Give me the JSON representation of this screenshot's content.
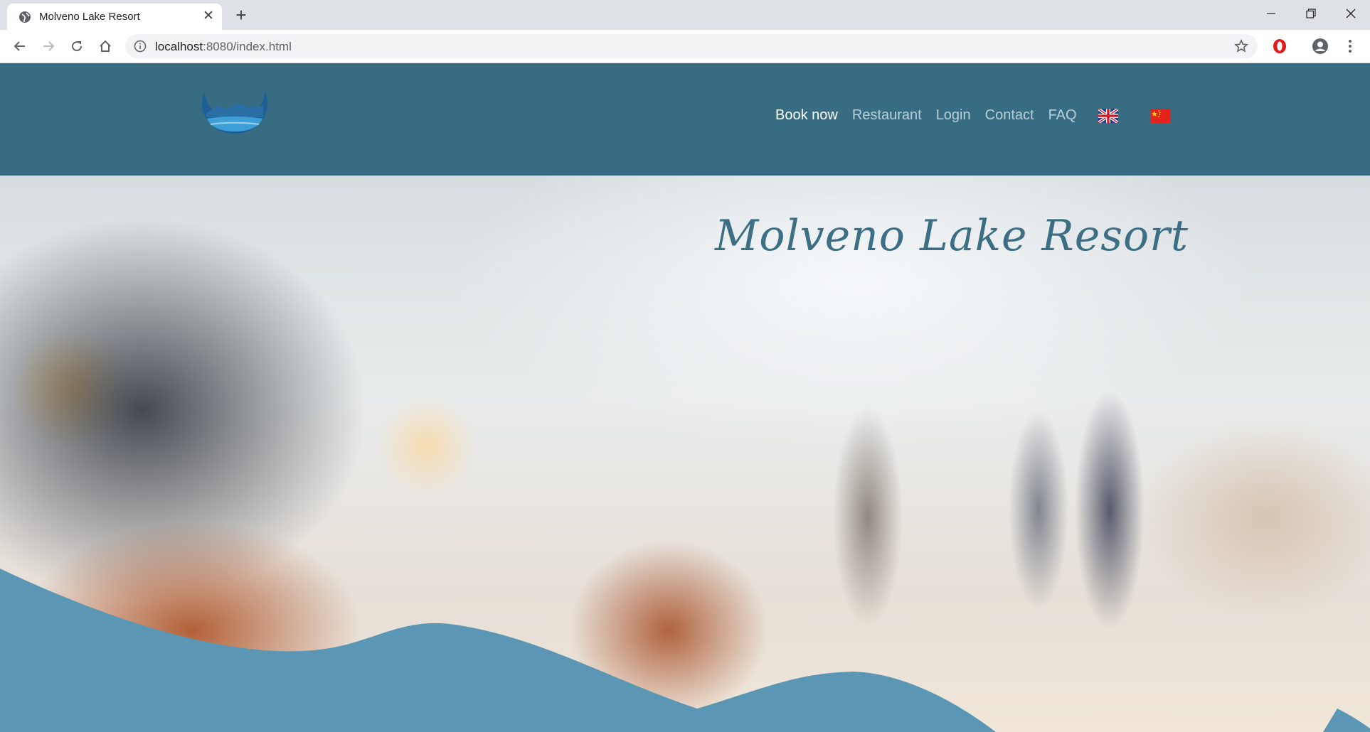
{
  "browser": {
    "tab_title": "Molveno Lake Resort",
    "url_host": "localhost",
    "url_rest": ":8080/index.html"
  },
  "site": {
    "nav": [
      {
        "label": "Book now",
        "active": true
      },
      {
        "label": "Restaurant",
        "active": false
      },
      {
        "label": "Login",
        "active": false
      },
      {
        "label": "Contact",
        "active": false
      },
      {
        "label": "FAQ",
        "active": false
      }
    ],
    "languages": [
      "english-flag-icon",
      "chinese-flag-icon"
    ],
    "hero_title": "Molveno Lake Resort",
    "colors": {
      "header_bg": "#386c82",
      "nav_active": "#ffffff",
      "nav_inactive": "#b9cfd9",
      "title": "#3d6f84",
      "wave": "#5b97b5"
    }
  }
}
